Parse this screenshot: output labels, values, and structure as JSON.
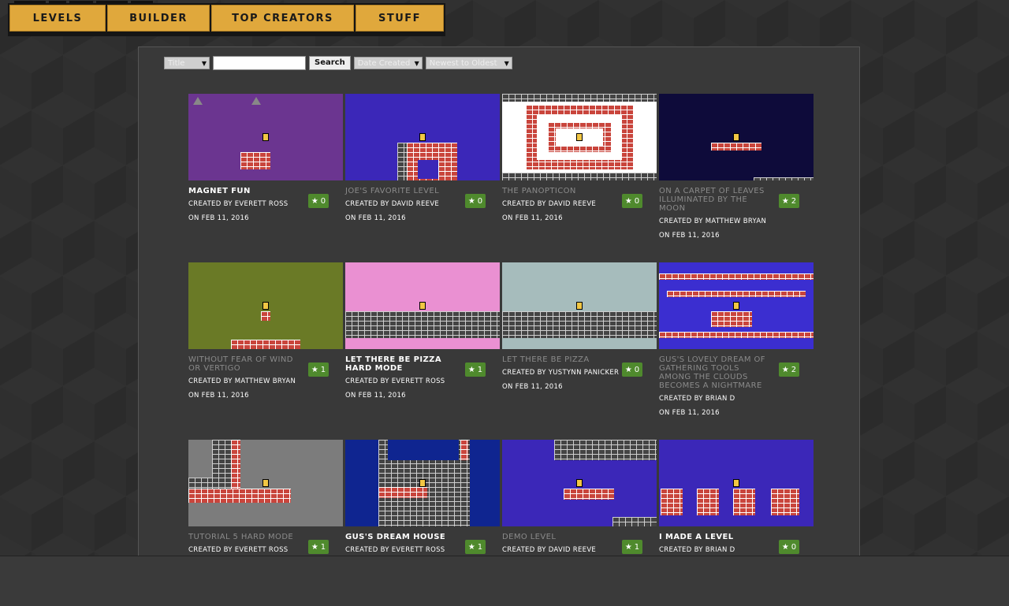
{
  "nav": {
    "items": [
      {
        "label": "LEVELS"
      },
      {
        "label": "BUILDER"
      },
      {
        "label": "TOP CREATORS"
      },
      {
        "label": "STUFF"
      }
    ]
  },
  "filters": {
    "field_select": "Title",
    "search_value": "",
    "search_button": "Search",
    "sort_select": "Date Created",
    "order_select": "Newest to Oldest"
  },
  "colors": {
    "accent": "#e0a83c",
    "star_badge": "#4f8a2d",
    "panel": "#393939"
  },
  "levels": [
    {
      "title": "MAGNET FUN",
      "creator": "CREATED BY EVERETT ROSS",
      "date": "ON FEB 11, 2016",
      "stars": "0",
      "bg": "#6b3590",
      "dim": false
    },
    {
      "title": "JOE'S FAVORITE LEVEL",
      "creator": "CREATED BY DAVID REEVE",
      "date": "ON FEB 11, 2016",
      "stars": "0",
      "bg": "#3b27b8",
      "dim": true
    },
    {
      "title": "THE PANOPTICON",
      "creator": "CREATED BY DAVID REEVE",
      "date": "ON FEB 11, 2016",
      "stars": "0",
      "bg": "#ffffff",
      "dim": true
    },
    {
      "title": "ON A CARPET OF LEAVES ILLUMINATED BY THE MOON",
      "creator": "CREATED BY MATTHEW BRYAN",
      "date": "ON FEB 11, 2016",
      "stars": "2",
      "bg": "#0e0b3a",
      "dim": true
    },
    {
      "title": "WITHOUT FEAR OF WIND OR VERTIGO",
      "creator": "CREATED BY MATTHEW BRYAN",
      "date": "ON FEB 11, 2016",
      "stars": "1",
      "bg": "#6a7a26",
      "dim": true
    },
    {
      "title": "LET THERE BE PIZZA HARD MODE",
      "creator": "CREATED BY EVERETT ROSS",
      "date": "ON FEB 11, 2016",
      "stars": "1",
      "bg": "#ea90d2",
      "dim": false
    },
    {
      "title": "LET THERE BE PIZZA",
      "creator": "CREATED BY YUSTYNN PANICKER",
      "date": "ON FEB 11, 2016",
      "stars": "0",
      "bg": "#a6bcbc",
      "dim": true
    },
    {
      "title": "GUS'S LOVELY DREAM OF GATHERING TOOLS AMONG THE CLOUDS BECOMES A NIGHTMARE",
      "creator": "CREATED BY BRIAN D",
      "date": "ON FEB 11, 2016",
      "stars": "2",
      "bg": "#3b2ed0",
      "dim": true
    },
    {
      "title": "TUTORIAL 5 HARD MODE",
      "creator": "CREATED BY EVERETT ROSS",
      "date": "",
      "stars": "1",
      "bg": "#7c7c7c",
      "dim": true
    },
    {
      "title": "GUS'S DREAM HOUSE",
      "creator": "CREATED BY EVERETT ROSS",
      "date": "",
      "stars": "1",
      "bg": "#0f2590",
      "dim": false
    },
    {
      "title": "DEMO LEVEL",
      "creator": "CREATED BY DAVID REEVE",
      "date": "",
      "stars": "1",
      "bg": "#3b27b8",
      "dim": true
    },
    {
      "title": "I MADE A LEVEL",
      "creator": "CREATED BY BRIAN D",
      "date": "",
      "stars": "0",
      "bg": "#3b27b8",
      "dim": false
    }
  ]
}
